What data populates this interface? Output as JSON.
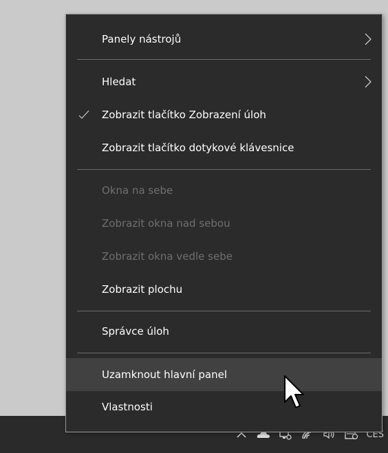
{
  "menu": {
    "items": [
      {
        "label": "Panely nástrojů",
        "submenu": true,
        "enabled": true
      },
      {
        "label": "Hledat",
        "submenu": true,
        "enabled": true
      },
      {
        "label": "Zobrazit tlačítko Zobrazení úloh",
        "checked": true,
        "enabled": true
      },
      {
        "label": "Zobrazit tlačítko dotykové klávesnice",
        "enabled": true
      },
      {
        "label": "Okna na sebe",
        "enabled": false
      },
      {
        "label": "Zobrazit okna nad sebou",
        "enabled": false
      },
      {
        "label": "Zobrazit okna vedle sebe",
        "enabled": false
      },
      {
        "label": "Zobrazit plochu",
        "enabled": true
      },
      {
        "label": "Správce úloh",
        "enabled": true
      },
      {
        "label": "Uzamknout hlavní panel",
        "enabled": true,
        "hovered": true
      },
      {
        "label": "Vlastnosti",
        "enabled": true
      }
    ]
  },
  "taskbar": {
    "tray_icons": [
      "chevron-up-icon",
      "onedrive-cloud-icon",
      "network-icon",
      "wifi-icon",
      "speaker-icon",
      "notification-icon"
    ],
    "language": "CES"
  },
  "colors": {
    "menu_bg": "#2b2b2b",
    "menu_text": "#ffffff",
    "disabled_text": "#6f6f6f",
    "hover_bg": "#414141",
    "separator": "#6b6b6b",
    "taskbar_bg": "#2a2a2a"
  }
}
